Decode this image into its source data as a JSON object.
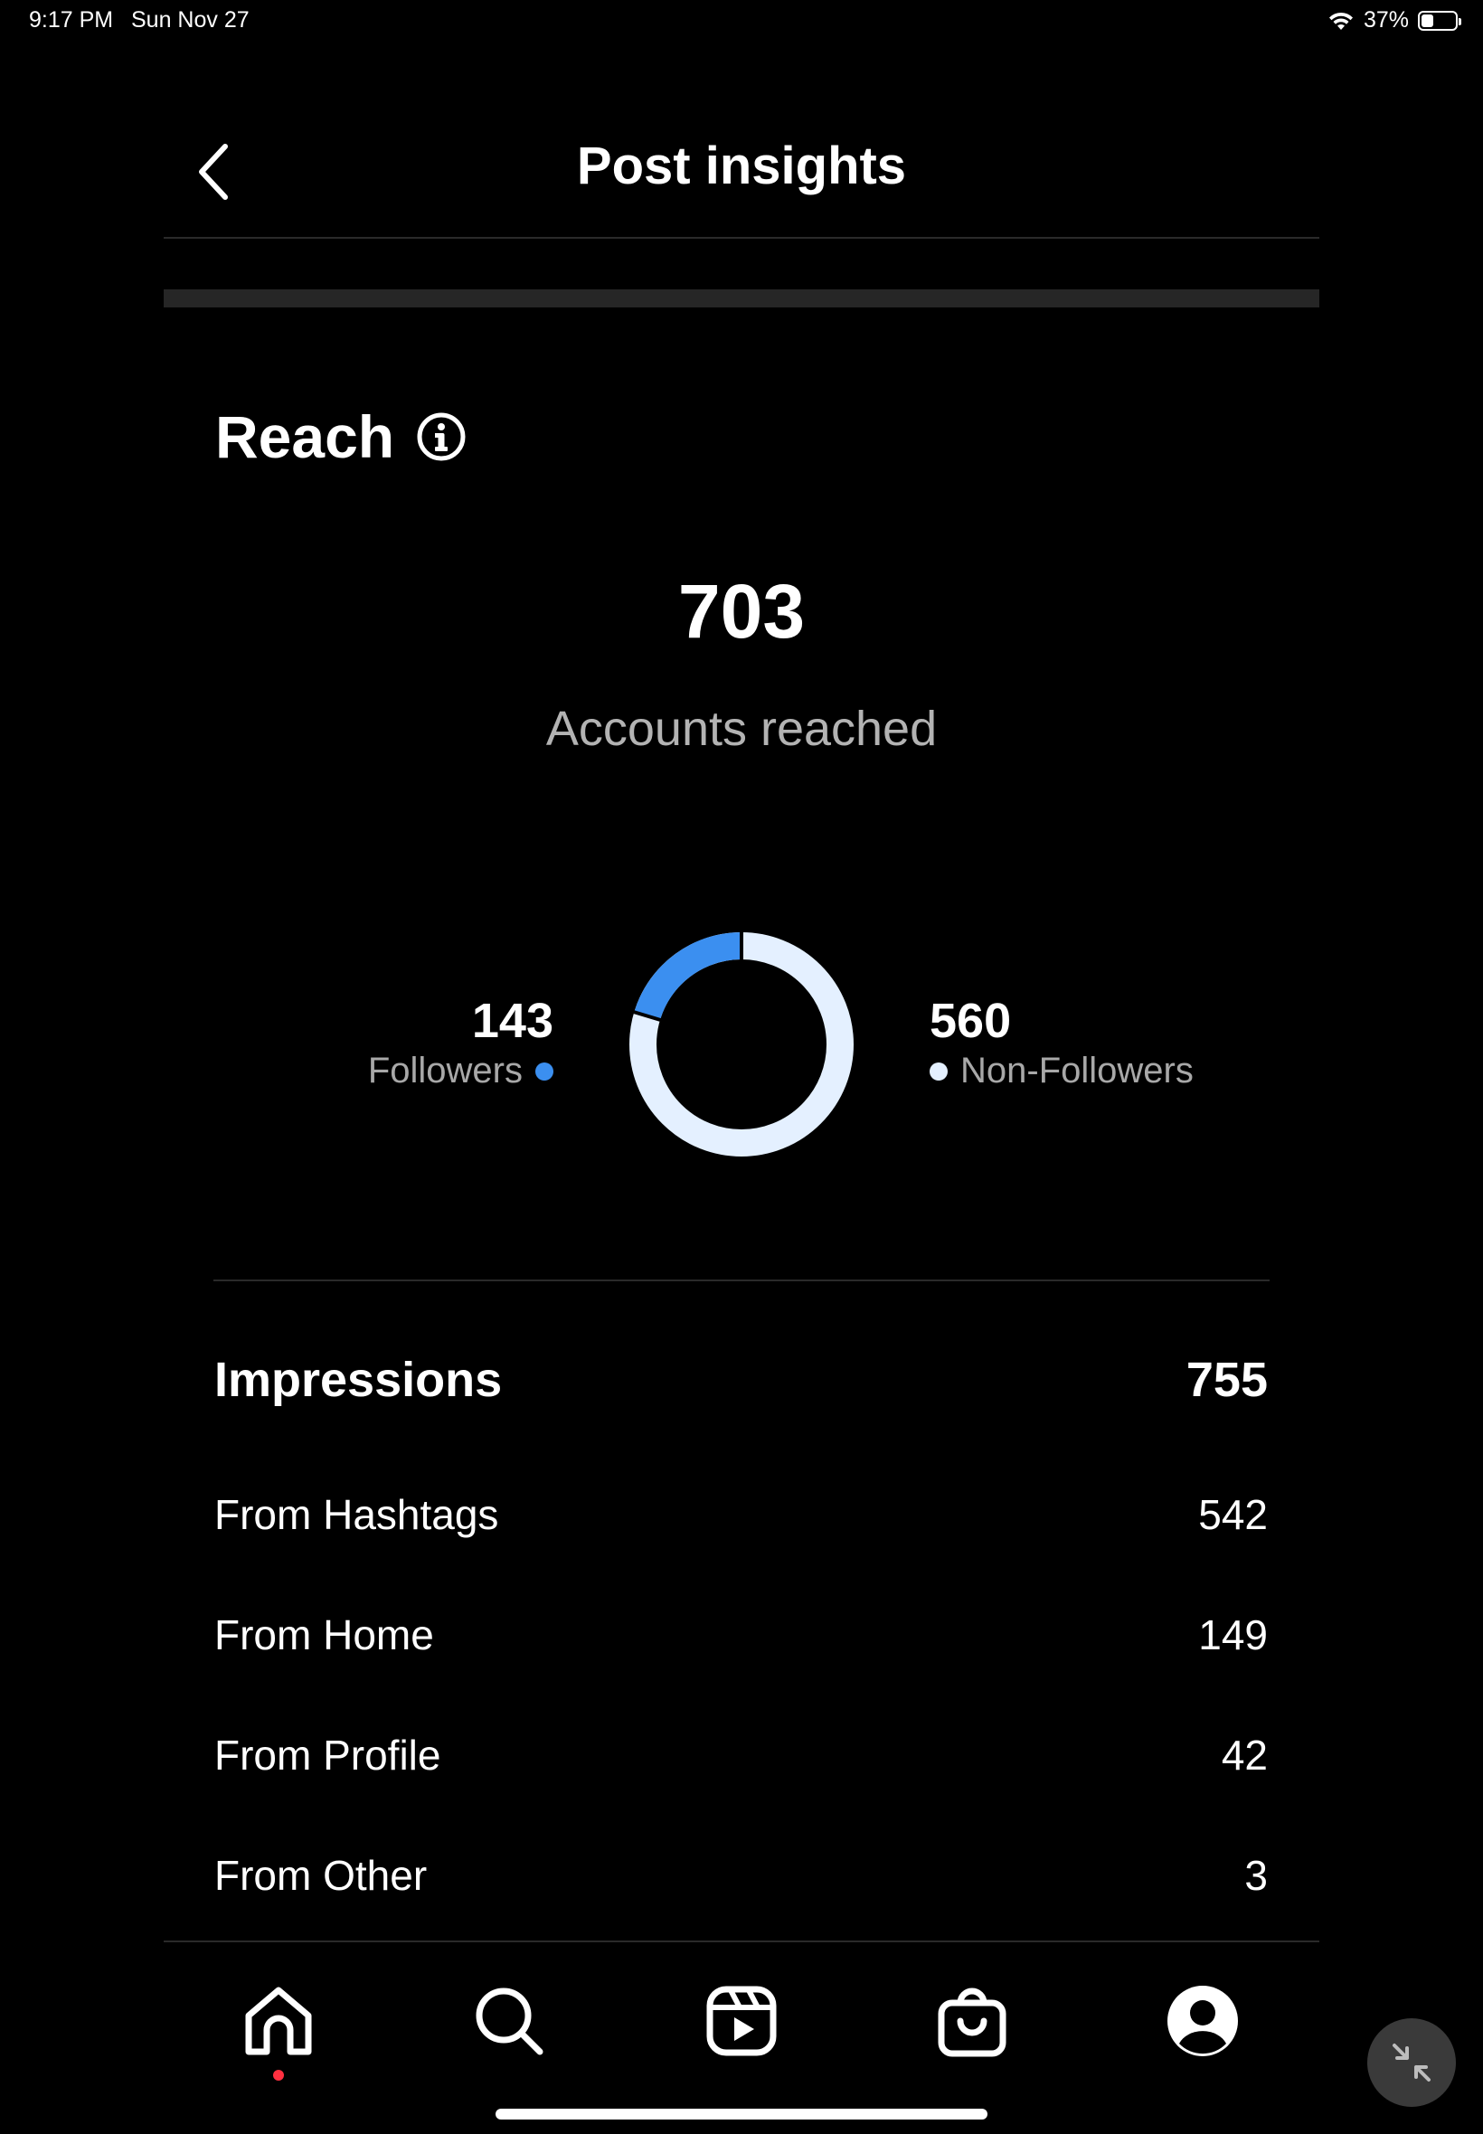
{
  "status_bar": {
    "time": "9:17 PM",
    "date": "Sun Nov 27",
    "battery": "37%",
    "battery_level": 0.37
  },
  "header": {
    "title": "Post insights",
    "back_icon": "chevron-left-icon"
  },
  "reach": {
    "title": "Reach",
    "info_icon": "info-icon",
    "accounts_reached": "703",
    "accounts_reached_label": "Accounts reached",
    "followers_count": "143",
    "followers_label": "Followers",
    "non_followers_count": "560",
    "non_followers_label": "Non-Followers",
    "followers_color": "#3b8ff0",
    "non_followers_color": "#e4f0ff"
  },
  "impressions": {
    "title": "Impressions",
    "total": "755",
    "rows": [
      {
        "label": "From Hashtags",
        "value": "542"
      },
      {
        "label": "From Home",
        "value": "149"
      },
      {
        "label": "From Profile",
        "value": "42"
      },
      {
        "label": "From Other",
        "value": "3"
      }
    ]
  },
  "nav": {
    "items": [
      "home-icon",
      "search-icon",
      "reels-icon",
      "shop-icon",
      "profile-icon"
    ],
    "active": "home-icon",
    "notification_color": "#ff3040"
  },
  "chart_data": {
    "type": "pie",
    "categories": [
      "Followers",
      "Non-Followers"
    ],
    "values": [
      143,
      560
    ],
    "title": "",
    "donut": true
  }
}
